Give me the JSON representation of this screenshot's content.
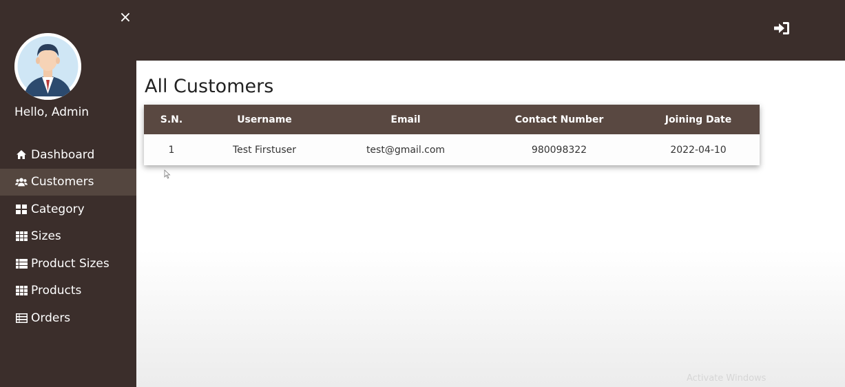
{
  "sidebar": {
    "greeting": "Hello, Admin",
    "items": [
      {
        "label": "Dashboard",
        "icon": "home-icon",
        "active": false
      },
      {
        "label": "Customers",
        "icon": "users-icon",
        "active": true
      },
      {
        "label": "Category",
        "icon": "grid-icon",
        "active": false
      },
      {
        "label": "Sizes",
        "icon": "table-icon",
        "active": false
      },
      {
        "label": "Product Sizes",
        "icon": "list-icon",
        "active": false
      },
      {
        "label": "Products",
        "icon": "table-icon",
        "active": false
      },
      {
        "label": "Orders",
        "icon": "list-alt-icon",
        "active": false
      }
    ]
  },
  "header": {
    "close_icon": "close-icon",
    "close_glyph": "×",
    "logout_icon": "sign-in-icon"
  },
  "main": {
    "title": "All Customers",
    "table": {
      "columns": [
        "S.N.",
        "Username",
        "Email",
        "Contact Number",
        "Joining Date"
      ],
      "rows": [
        [
          "1",
          "Test Firstuser",
          "test@gmail.com",
          "980098322",
          "2022-04-10"
        ]
      ]
    },
    "watermark": "Activate Windows"
  },
  "colors": {
    "sidebar_bg": "#3b2e2b",
    "active_item_bg": "#54463f",
    "table_header_bg": "#594841"
  }
}
